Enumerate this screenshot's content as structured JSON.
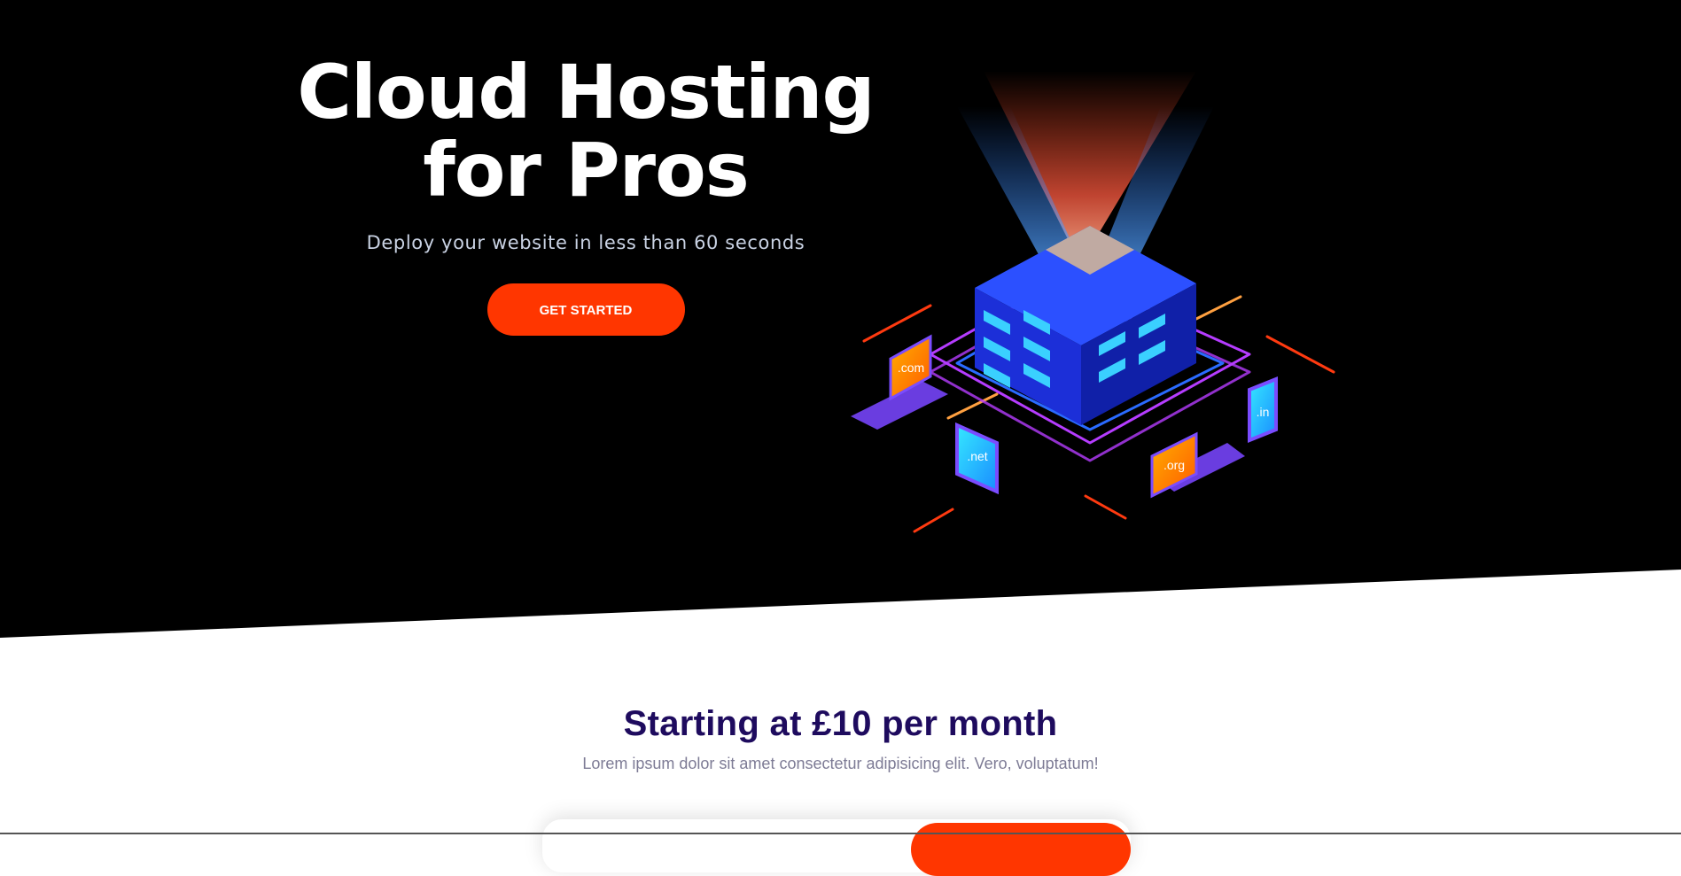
{
  "hero": {
    "title_line1": "Cloud Hosting",
    "title_line2": "for Pros",
    "subtitle": "Deploy your website in less than 60 seconds",
    "cta_label": "GET STARTED"
  },
  "illustration": {
    "devices": [
      ".com",
      ".net",
      ".org",
      ".in"
    ]
  },
  "pricing": {
    "title": "Starting at £10 per month",
    "subtitle": "Lorem ipsum dolor sit amet consectetur adipisicing elit. Vero, voluptatum!"
  },
  "colors": {
    "hero_bg": "#000000",
    "accent": "#ff3600",
    "heading_dark": "#1e0b5e",
    "muted_text": "#7d7b95"
  }
}
